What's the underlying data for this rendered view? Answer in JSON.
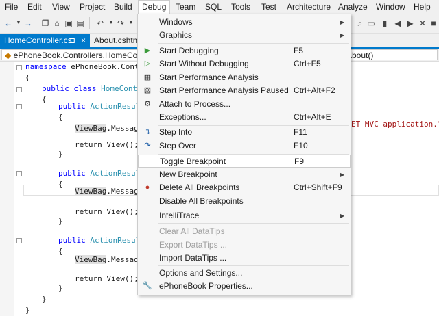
{
  "menubar": [
    "File",
    "Edit",
    "View",
    "Project",
    "Build",
    "Debug",
    "Team",
    "SQL",
    "Tools",
    "Test",
    "Architecture",
    "Analyze",
    "Window",
    "Help"
  ],
  "tabs": {
    "home": "HomeController.cs",
    "home_pin": "⊐",
    "home_close": "×",
    "about": "About.cshtml"
  },
  "nav": {
    "left": "ePhoneBook.Controllers.HomeController",
    "right": "About()"
  },
  "code": {
    "namespace_kw": "namespace",
    "namespace_name": " ePhoneBook.Contro",
    "brace_open": "{",
    "brace_close": "}",
    "public_class": "public class",
    "class_name": " HomeContro",
    "public": "public",
    "action_result": " ActionResult",
    "viewbag": "ViewBag",
    "message": ".Messag",
    "string_tail": "ET MVC application.\";",
    "return_stmt": "return View();"
  },
  "debug_menu": {
    "windows": "Windows",
    "graphics": "Graphics",
    "start_debugging": "Start Debugging",
    "start_debugging_sc": "F5",
    "start_without": "Start Without Debugging",
    "start_without_sc": "Ctrl+F5",
    "start_perf": "Start Performance Analysis",
    "start_perf_paused": "Start Performance Analysis Paused",
    "start_perf_paused_sc": "Ctrl+Alt+F2",
    "attach": "Attach to Process...",
    "exceptions": "Exceptions...",
    "exceptions_sc": "Ctrl+Alt+E",
    "step_into": "Step Into",
    "step_into_sc": "F11",
    "step_over": "Step Over",
    "step_over_sc": "F10",
    "toggle_bp": "Toggle Breakpoint",
    "toggle_bp_sc": "F9",
    "new_bp": "New Breakpoint",
    "delete_all_bp": "Delete All Breakpoints",
    "delete_all_bp_sc": "Ctrl+Shift+F9",
    "disable_all_bp": "Disable All Breakpoints",
    "intellitrace": "IntelliTrace",
    "clear_datatips": "Clear All DataTips",
    "export_datatips": "Export DataTips ...",
    "import_datatips": "Import DataTips ...",
    "options": "Options and Settings...",
    "properties": "ePhoneBook Properties..."
  },
  "colors": {
    "accent": "#007acc",
    "play_green": "#3a9a3a"
  }
}
